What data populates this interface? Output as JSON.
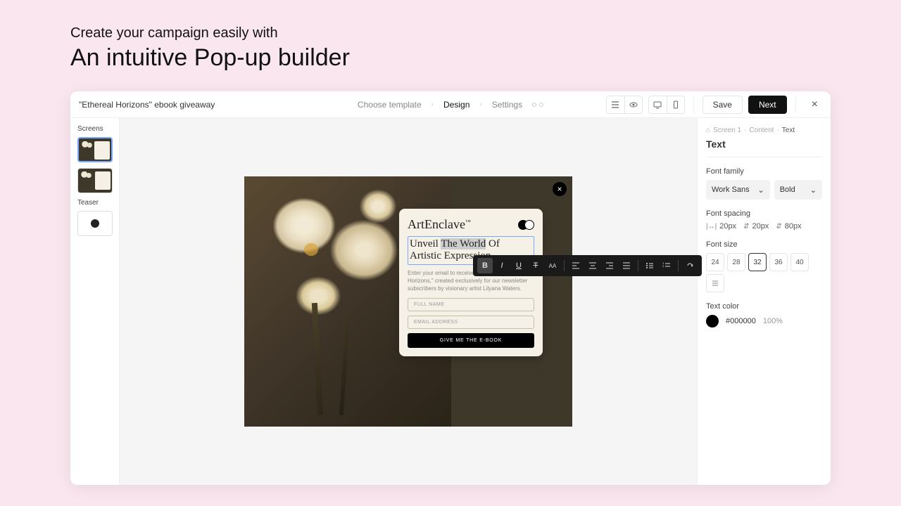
{
  "hero": {
    "subtitle": "Create your campaign easily with",
    "title": "An intuitive Pop-up builder"
  },
  "topbar": {
    "campaign_name": "\"Ethereal Horizons\" ebook giveaway",
    "steps": [
      "Choose template",
      "Design",
      "Settings"
    ],
    "active_step": 1,
    "save_label": "Save",
    "next_label": "Next"
  },
  "sidebar": {
    "screens_label": "Screens",
    "teaser_label": "Teaser"
  },
  "popup": {
    "brand": "ArtEnclave",
    "brand_tm": "™",
    "heading_pre": "Unveil ",
    "heading_sel": "The World",
    "heading_post": " Of Artistic Expression",
    "description": "Enter your email to receive the e-book, \"Ethereal Horizons,\" created exclusively for our newsletter subscribers by visionary artist Lilyana Waters.",
    "name_placeholder": "FULL NAME",
    "email_placeholder": "EMAIL ADDRESS",
    "cta_label": "GIVE ME THE E-BOOK"
  },
  "inspector": {
    "breadcrumb": [
      "Screen 1",
      "Content",
      "Text"
    ],
    "title": "Text",
    "font_family_label": "Font family",
    "font_family_value": "Work Sans",
    "font_weight_value": "Bold",
    "font_spacing_label": "Font spacing",
    "spacing_values": [
      "20px",
      "20px",
      "80px"
    ],
    "font_size_label": "Font size",
    "font_sizes": [
      "24",
      "28",
      "32",
      "36",
      "40"
    ],
    "active_size": "32",
    "text_color_label": "Text color",
    "color_hex": "#000000",
    "color_opacity": "100%"
  }
}
